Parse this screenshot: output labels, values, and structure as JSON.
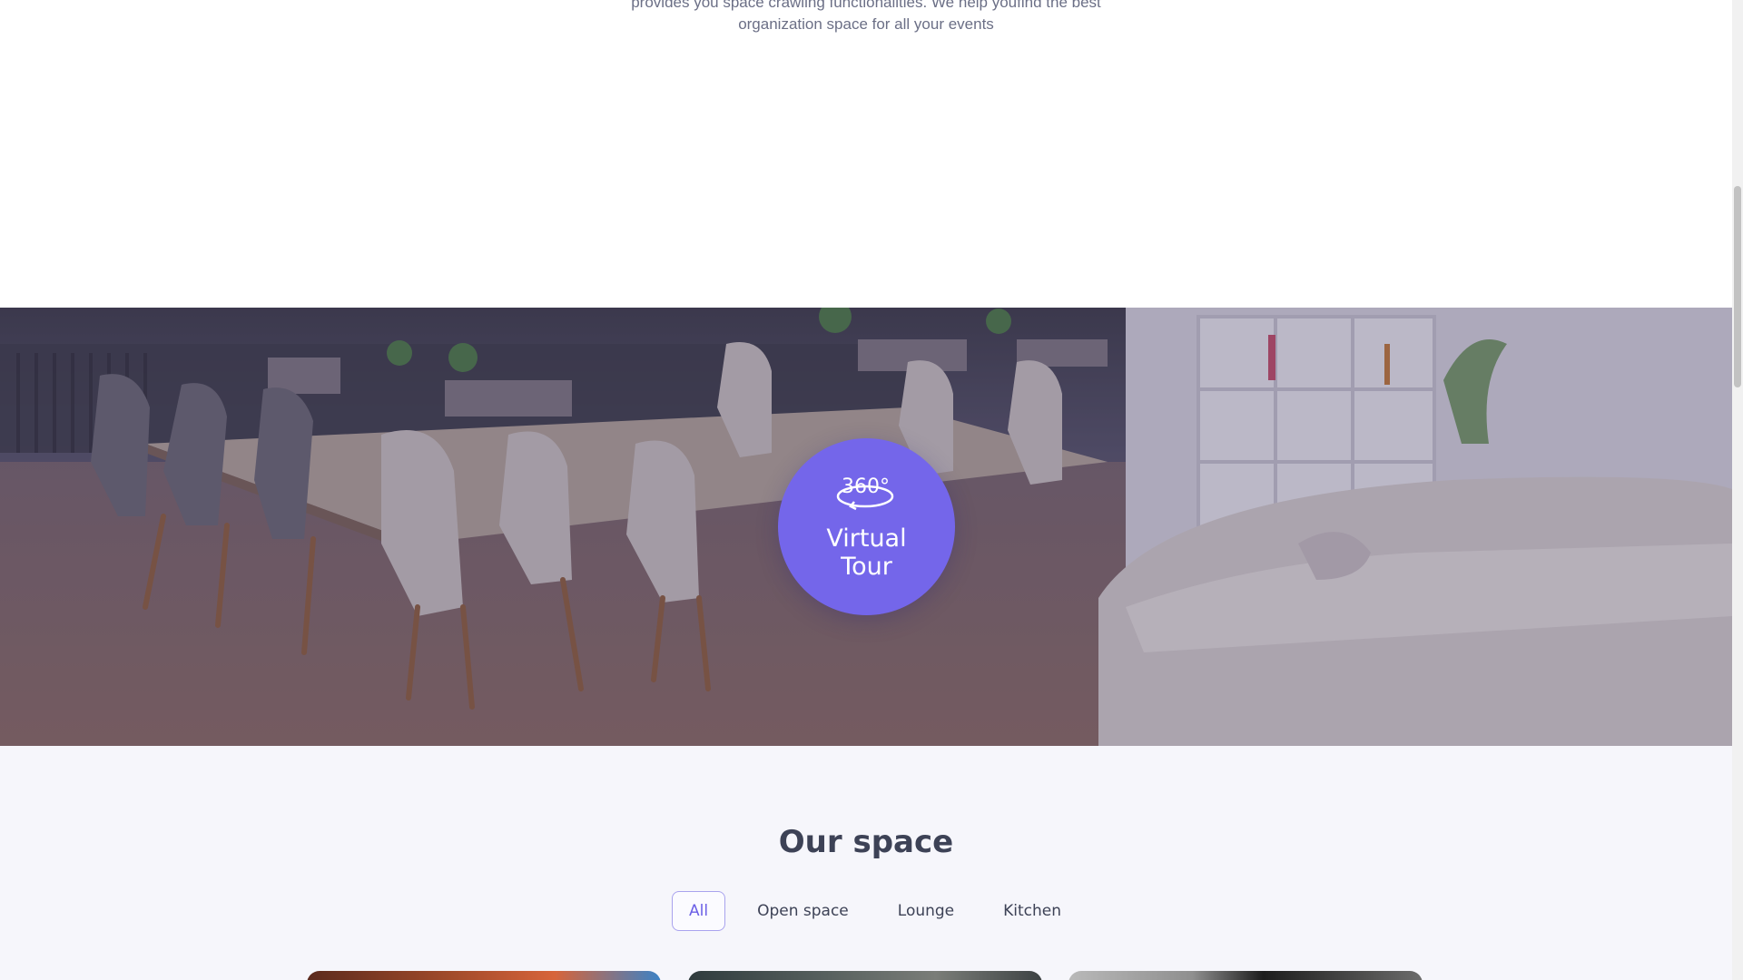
{
  "intro": {
    "line1": "provides you space crawling functionalities. We help youfind the best",
    "line2": "organization space for all your events"
  },
  "virtual_tour": {
    "icon_text": "360°",
    "label_line1": "Virtual",
    "label_line2": "Tour",
    "accent_color": "#7466ea"
  },
  "our_space": {
    "title": "Our space",
    "filters": [
      {
        "label": "All",
        "active": true
      },
      {
        "label": "Open space",
        "active": false
      },
      {
        "label": "Lounge",
        "active": false
      },
      {
        "label": "Kitchen",
        "active": false
      }
    ]
  }
}
